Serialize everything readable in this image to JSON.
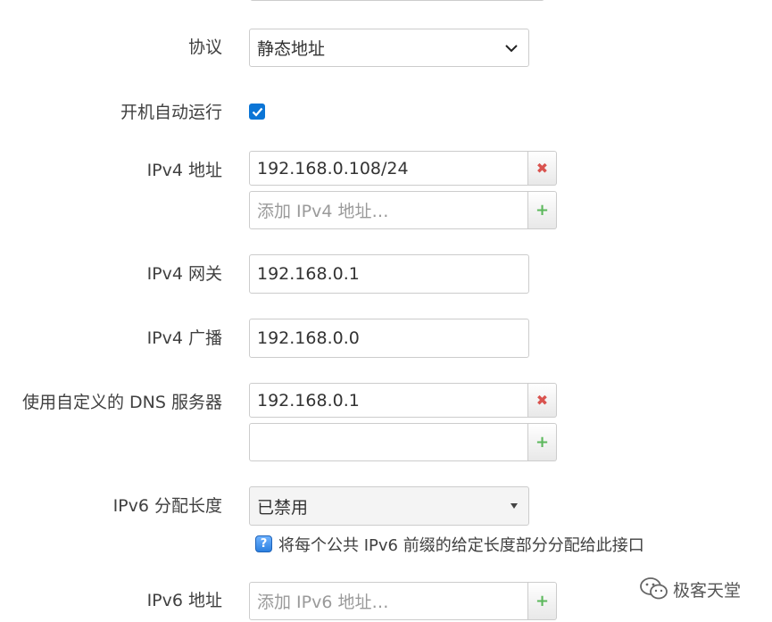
{
  "form": {
    "protocol": {
      "label": "协议",
      "value": "静态地址"
    },
    "autostart": {
      "label": "开机自动运行",
      "checked": true
    },
    "ipv4_address": {
      "label": "IPv4 地址",
      "value": "192.168.0.108/24",
      "add_placeholder": "添加 IPv4 地址…"
    },
    "ipv4_gateway": {
      "label": "IPv4 网关",
      "value": "192.168.0.1"
    },
    "ipv4_broadcast": {
      "label": "IPv4 广播",
      "value": "192.168.0.0"
    },
    "dns": {
      "label": "使用自定义的 DNS 服务器",
      "value": "192.168.0.1",
      "empty_value": ""
    },
    "ipv6_assign": {
      "label": "IPv6 分配长度",
      "value": "已禁用",
      "help": "将每个公共 IPv6 前缀的给定长度部分分配给此接口"
    },
    "ipv6_address": {
      "label": "IPv6 地址",
      "placeholder": "添加 IPv6 地址…"
    }
  },
  "icons": {
    "remove": "remove-icon",
    "add": "add-icon",
    "help": "help-icon",
    "dropdown": "chevron-down-icon"
  },
  "glyphs": {
    "remove": "✖",
    "add": "+",
    "help": "?"
  },
  "watermark": {
    "text": "极客天堂"
  },
  "colors": {
    "checkbox": "#0b75d6",
    "remove": "#d9534f",
    "add": "#5cb85c",
    "help": "#2b7fe0"
  }
}
